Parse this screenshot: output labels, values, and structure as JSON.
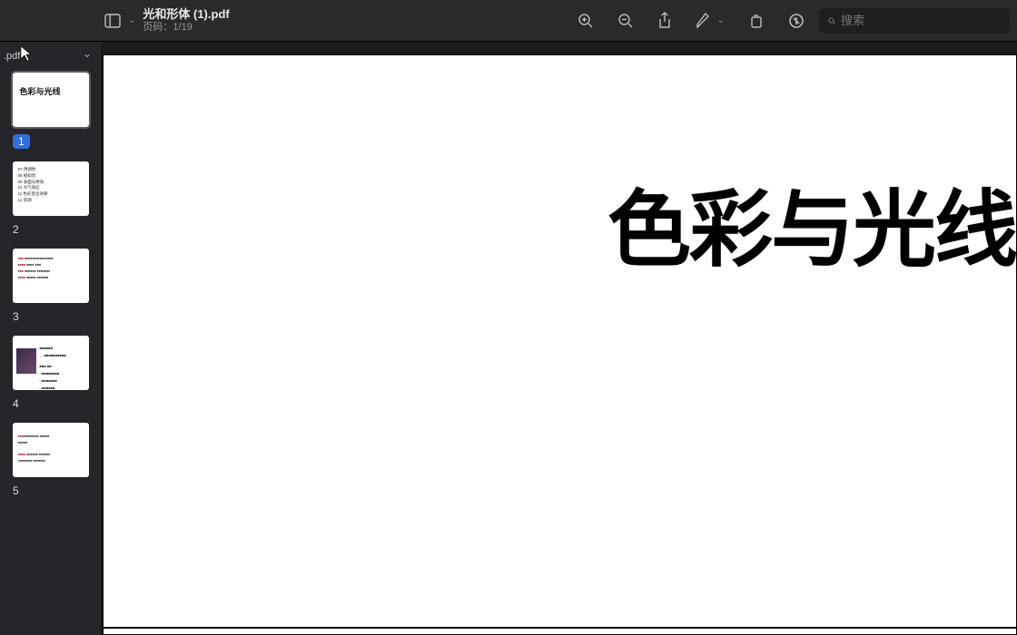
{
  "header": {
    "title": "光和形体 (1).pdf",
    "page_label": "页码：1/19"
  },
  "search": {
    "placeholder": "搜索"
  },
  "sidebar": {
    "ext_label": ".pdf",
    "thumbnails": [
      {
        "num": "1",
        "title": "色彩与光线",
        "selected": true
      },
      {
        "num": "2",
        "toc": [
          "07 预调色",
          "08 视知觉",
          "09 表面与特效",
          "10 大气效应",
          "11 色彩变化效果",
          "12 资源"
        ]
      },
      {
        "num": "3"
      },
      {
        "num": "4"
      },
      {
        "num": "5"
      }
    ]
  },
  "page": {
    "title": "色彩与光线"
  }
}
